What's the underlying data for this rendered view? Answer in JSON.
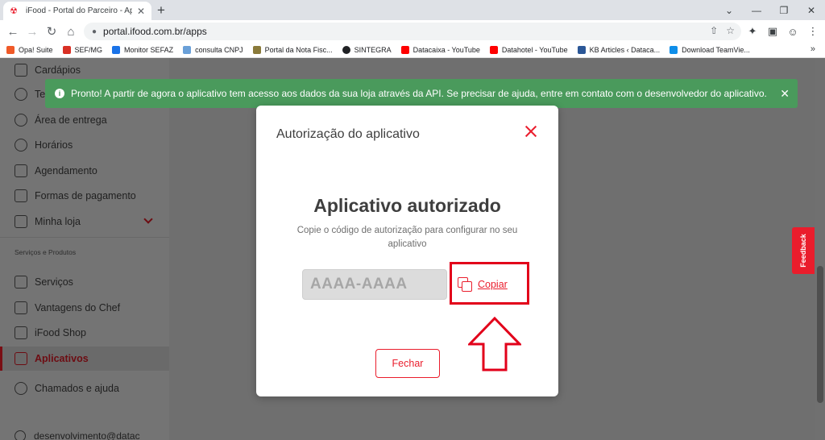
{
  "browser": {
    "tab_title": "iFood - Portal do Parceiro - Aplic",
    "url": "portal.ifood.com.br/apps",
    "bookmarks": [
      {
        "label": "Opa! Suite",
        "icon": "opa-suite-icon",
        "color": "#f05a28"
      },
      {
        "label": "SEF/MG",
        "icon": "sef-mg-icon",
        "color": "#d93025"
      },
      {
        "label": "Monitor SEFAZ",
        "icon": "monitor-sefaz-icon",
        "color": "#1a73e8"
      },
      {
        "label": "consulta CNPJ",
        "icon": "consulta-cnpj-icon",
        "color": "#6aa0d8"
      },
      {
        "label": "Portal da Nota Fisc...",
        "icon": "portal-nota-fiscal-icon",
        "color": "#8a7a3a"
      },
      {
        "label": "SINTEGRA",
        "icon": "sintegra-icon",
        "color": "#202124"
      },
      {
        "label": "Datacaixa - YouTube",
        "icon": "youtube-icon",
        "color": "#ff0000"
      },
      {
        "label": "Datahotel - YouTube",
        "icon": "youtube-icon",
        "color": "#ff0000"
      },
      {
        "label": "KB Articles ‹ Dataca...",
        "icon": "kb-articles-icon",
        "color": "#2b5797"
      },
      {
        "label": "Download TeamVie...",
        "icon": "teamviewer-icon",
        "color": "#0e8ee9"
      }
    ]
  },
  "sidebar": {
    "items": [
      {
        "label": "Cardápios",
        "icon": "menu-book-icon"
      },
      {
        "label": "Te",
        "icon": "clock-icon"
      },
      {
        "label": "Área de entrega",
        "icon": "map-pin-icon"
      },
      {
        "label": "Horários",
        "icon": "clock-icon"
      },
      {
        "label": "Agendamento",
        "icon": "calendar-icon"
      },
      {
        "label": "Formas de pagamento",
        "icon": "credit-card-icon"
      },
      {
        "label": "Minha loja",
        "icon": "store-icon"
      }
    ],
    "section_label": "Serviços e Produtos",
    "section_items": [
      {
        "label": "Serviços",
        "icon": "tools-icon"
      },
      {
        "label": "Vantagens do Chef",
        "icon": "chef-hat-icon"
      },
      {
        "label": "iFood Shop",
        "icon": "shopping-bag-icon"
      },
      {
        "label": "Aplicativos",
        "icon": "apps-grid-icon",
        "active": true
      },
      {
        "label": "Chamados e ajuda",
        "icon": "help-icon"
      }
    ],
    "user_email": "desenvolvimento@datac"
  },
  "toast": {
    "message": "Pronto! A partir de agora o aplicativo tem acesso aos dados da sua loja através da API. Se precisar de ajuda, entre em contato com o desenvolvedor do aplicativo.",
    "color": "#4a9a5c"
  },
  "feedback_label": "Feedback",
  "modal": {
    "title": "Autorização do aplicativo",
    "heading": "Aplicativo autorizado",
    "description": "Copie o código de autorização para configurar no seu aplicativo",
    "code": "AAAA-AAAA",
    "copy_label": "Copiar",
    "close_label": "Fechar"
  },
  "colors": {
    "brand_red": "#ea1d2c",
    "highlight": "#e2001a"
  }
}
